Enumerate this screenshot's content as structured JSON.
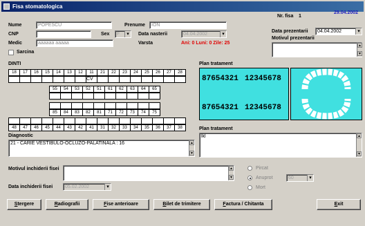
{
  "window": {
    "title": "Fisa stomatologica"
  },
  "patient": {
    "nume_label": "Nume",
    "nume_value": "POPESCU",
    "prenume_label": "Prenume",
    "prenume_value": "ION",
    "cnp_label": "CNP",
    "cnp_value": "",
    "sex_label": "Sex",
    "sex_value": "F",
    "data_nasterii_label": "Data nasterii",
    "data_nasterii_value": "04.04.2002",
    "medic_label": "Medic",
    "medic_value": "aaaaaa aaaaa",
    "varsta_label": "Varsta",
    "varsta_value": "Ani: 0 Luni: 0 Zile: 25",
    "sarcina_label": "Sarcina"
  },
  "fisa": {
    "nr_label": "Nr. fisa",
    "nr_value": "1",
    "date": "29.04.2002",
    "prezentare_label": "Data prezentarii",
    "prezentare_value": "04.04.2002",
    "motiv_label": "Motivul prezentarii",
    "motiv_value": ""
  },
  "dinti": {
    "title": "DINTI",
    "row1": [
      "18",
      "17",
      "16",
      "15",
      "14",
      "13",
      "12",
      "11",
      "21",
      "22",
      "23",
      "24",
      "25",
      "26",
      "27",
      "28"
    ],
    "row1_marks": [
      "",
      "",
      "",
      "",
      "",
      "",
      "",
      "CV",
      "",
      "",
      "",
      "",
      "",
      "",
      "",
      ""
    ],
    "row2": [
      "55",
      "54",
      "53",
      "52",
      "51",
      "61",
      "62",
      "63",
      "64",
      "65"
    ],
    "row3": [
      "85",
      "84",
      "83",
      "82",
      "81",
      "71",
      "72",
      "73",
      "74",
      "75"
    ],
    "row4": [
      "48",
      "47",
      "46",
      "45",
      "44",
      "43",
      "42",
      "41",
      "31",
      "32",
      "33",
      "34",
      "35",
      "36",
      "37",
      "38"
    ]
  },
  "diagnostic": {
    "label": "Diagnostic",
    "value": "21 - CARIE VESTIBULO-OCLUZO-PALATINALA : 16"
  },
  "plan": {
    "title": "Plan tratament",
    "upper_left": "87654321",
    "upper_right": "12345678",
    "lower_left": "87654321",
    "lower_right": "12345678",
    "tratament_label": "Plan tratament",
    "tratament_value": "lkl"
  },
  "inchidere": {
    "motiv_label": "Motivul inchiderii fisei",
    "data_label": "Data inchiderii fisei",
    "data_value": "05.02.2002",
    "opt1": "Pircat",
    "opt2": "Anuprot",
    "opt2_value": "60",
    "opt3": "Mort"
  },
  "buttons": {
    "stergere": "Stergere",
    "radiografii": "Radiografii",
    "fise": "Fise anterioare",
    "bilet": "Bilet de trimitere",
    "factura": "Factura / Chitanta",
    "exit": "Exit"
  }
}
